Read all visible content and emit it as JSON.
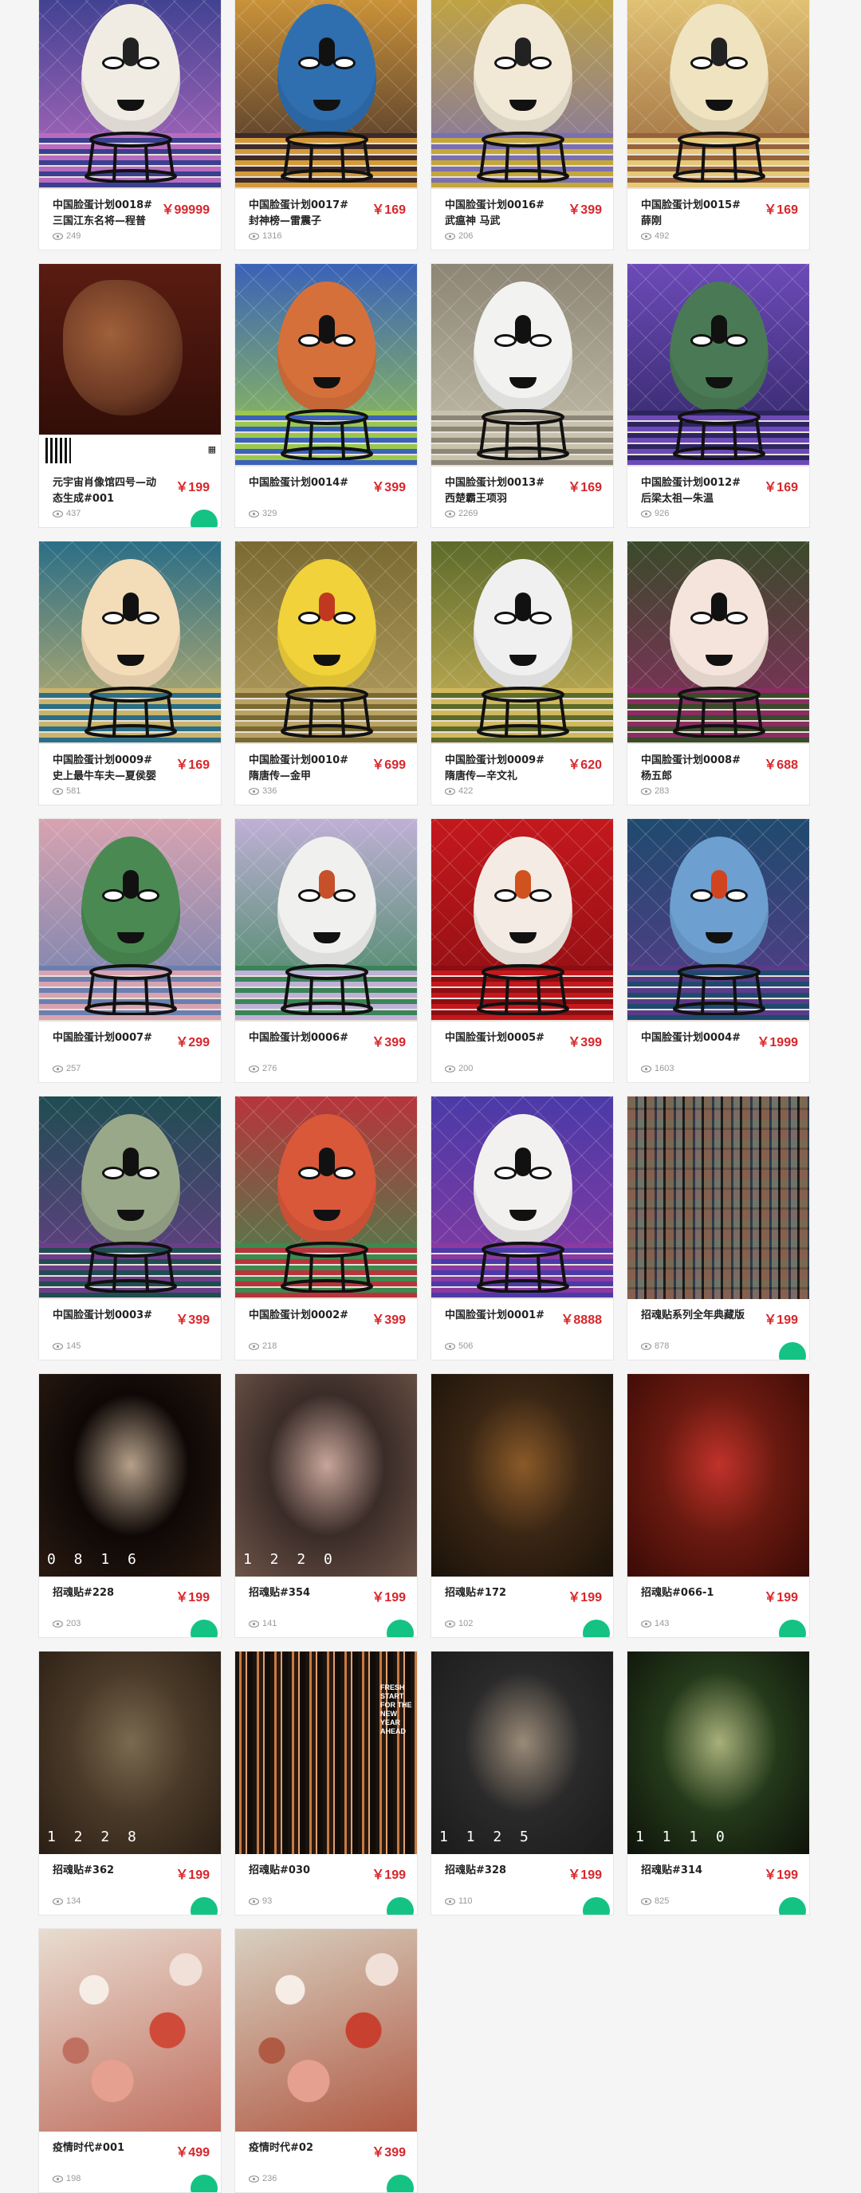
{
  "cards": [
    {
      "title": "中国脸蛋计划0018# 三国江东名将—程普",
      "price": "￥99999",
      "views": "249",
      "badge": false,
      "art": "egg",
      "bg": [
        "#3a3f8f",
        "#b86cc0"
      ],
      "egg": "#f0ece4",
      "accent": "#222"
    },
    {
      "title": "中国脸蛋计划0017# 封神榜—雷震子",
      "price": "￥169",
      "views": "1316",
      "badge": false,
      "art": "egg",
      "bg": [
        "#d49a3a",
        "#3d2a2a"
      ],
      "egg": "#2f6fb0",
      "accent": "#111"
    },
    {
      "title": "中国脸蛋计划0016# 武瘟神 马武",
      "price": "￥399",
      "views": "206",
      "badge": false,
      "art": "egg",
      "bg": [
        "#c4a73a",
        "#7a6fb3"
      ],
      "egg": "#f1e9d6",
      "accent": "#222"
    },
    {
      "title": "中国脸蛋计划0015#薛刚",
      "price": "￥169",
      "views": "492",
      "badge": false,
      "art": "egg",
      "bg": [
        "#e6c978",
        "#96623a"
      ],
      "egg": "#efe3c0",
      "accent": "#222"
    },
    {
      "title": "元宇宙肖像馆四号—动态生成#001",
      "price": "￥199",
      "views": "437",
      "badge": true,
      "art": "portrait",
      "bg": [
        "#5a1c12",
        "#2a0b06"
      ],
      "egg": "#6d3a24",
      "accent": "#111"
    },
    {
      "title": "中国脸蛋计划0014#",
      "price": "￥399",
      "views": "329",
      "badge": false,
      "art": "egg",
      "bg": [
        "#3a62b8",
        "#9ac84d"
      ],
      "egg": "#d6703b",
      "accent": "#111"
    },
    {
      "title": "中国脸蛋计划0013# 西楚霸王项羽",
      "price": "￥169",
      "views": "2269",
      "badge": false,
      "art": "egg",
      "bg": [
        "#8d8575",
        "#c6c2ad"
      ],
      "egg": "#f2f2f0",
      "accent": "#111"
    },
    {
      "title": "中国脸蛋计划0012# 后梁太祖—朱温",
      "price": "￥169",
      "views": "926",
      "badge": false,
      "art": "egg",
      "bg": [
        "#6c4ab8",
        "#2d2560"
      ],
      "egg": "#4a7a55",
      "accent": "#111"
    },
    {
      "title": "中国脸蛋计划0009# 史上最牛车夫—夏侯婴",
      "price": "￥169",
      "views": "581",
      "badge": false,
      "art": "egg",
      "bg": [
        "#2b6e86",
        "#c9b46c"
      ],
      "egg": "#f3dcb8",
      "accent": "#111"
    },
    {
      "title": "中国脸蛋计划0010# 隋唐传—金甲",
      "price": "￥699",
      "views": "336",
      "badge": false,
      "art": "egg",
      "bg": [
        "#7a6a32",
        "#b9a363"
      ],
      "egg": "#f2d23a",
      "accent": "#c0381f"
    },
    {
      "title": "中国脸蛋计划0009# 隋唐传—辛文礼",
      "price": "￥620",
      "views": "422",
      "badge": false,
      "art": "egg",
      "bg": [
        "#5c6a2a",
        "#d1b85c"
      ],
      "egg": "#f0f0f0",
      "accent": "#111"
    },
    {
      "title": "中国脸蛋计划0008#杨五郎",
      "price": "￥688",
      "views": "283",
      "badge": false,
      "art": "egg",
      "bg": [
        "#3a4a2a",
        "#8b2c63"
      ],
      "egg": "#f5e4dc",
      "accent": "#111"
    },
    {
      "title": "中国脸蛋计划0007#",
      "price": "￥299",
      "views": "257",
      "badge": false,
      "art": "egg",
      "bg": [
        "#d8a3b0",
        "#6a7fb0"
      ],
      "egg": "#4a8a52",
      "accent": "#111"
    },
    {
      "title": "中国脸蛋计划0006#",
      "price": "￥399",
      "views": "276",
      "badge": false,
      "art": "egg",
      "bg": [
        "#bfb0d6",
        "#3a8458"
      ],
      "egg": "#f0f0ee",
      "accent": "#c6502a"
    },
    {
      "title": "中国脸蛋计划0005#",
      "price": "￥399",
      "views": "200",
      "badge": false,
      "art": "egg",
      "bg": [
        "#c4181d",
        "#8a0e12"
      ],
      "egg": "#f4ece4",
      "accent": "#d0521f"
    },
    {
      "title": "中国脸蛋计划0004#",
      "price": "￥1999",
      "views": "1603",
      "badge": false,
      "art": "egg",
      "bg": [
        "#1f4a6e",
        "#5a3b8a"
      ],
      "egg": "#6d9fd1",
      "accent": "#d04420"
    },
    {
      "title": "中国脸蛋计划0003#",
      "price": "￥399",
      "views": "145",
      "badge": false,
      "art": "egg",
      "bg": [
        "#1f4d52",
        "#6e3d8a"
      ],
      "egg": "#9aa88a",
      "accent": "#111"
    },
    {
      "title": "中国脸蛋计划0002#",
      "price": "￥399",
      "views": "218",
      "badge": false,
      "art": "egg",
      "bg": [
        "#b8343b",
        "#3c8a4d"
      ],
      "egg": "#d9583a",
      "accent": "#111"
    },
    {
      "title": "中国脸蛋计划0001#",
      "price": "￥8888",
      "views": "506",
      "badge": false,
      "art": "egg",
      "bg": [
        "#4b3aa8",
        "#8b3aa0"
      ],
      "egg": "#f3f1ef",
      "accent": "#111"
    },
    {
      "title": "招魂贴系列全年典藏版",
      "price": "￥199",
      "views": "878",
      "badge": true,
      "art": "mosaic",
      "bg": [
        "#222",
        "#111"
      ],
      "egg": "#888",
      "accent": "#111"
    },
    {
      "title": "招魂贴#228",
      "price": "￥199",
      "views": "203",
      "badge": true,
      "art": "poster",
      "bg": [
        "#2a1a10",
        "#0e0806"
      ],
      "egg": "#b5a08a",
      "accent": "#fff",
      "overlay": "0 8",
      "overlay2": "1 6"
    },
    {
      "title": "招魂贴#354",
      "price": "￥199",
      "views": "141",
      "badge": true,
      "art": "poster",
      "bg": [
        "#6e5448",
        "#3a2c28"
      ],
      "egg": "#c7a59a",
      "accent": "#fff",
      "overlay": "1 2",
      "overlay2": "2 0"
    },
    {
      "title": "招魂贴#172",
      "price": "￥199",
      "views": "102",
      "badge": true,
      "art": "poster",
      "bg": [
        "#1a120a",
        "#3a2614"
      ],
      "egg": "#8a5a28",
      "accent": "#fff",
      "overlay": "",
      "overlay2": ""
    },
    {
      "title": "招魂贴#066-1",
      "price": "￥199",
      "views": "143",
      "badge": true,
      "art": "poster",
      "bg": [
        "#3a0a06",
        "#6a1a10"
      ],
      "egg": "#c0322a",
      "accent": "#fff",
      "overlay": "",
      "overlay2": ""
    },
    {
      "title": "招魂贴#362",
      "price": "￥199",
      "views": "134",
      "badge": true,
      "art": "poster",
      "bg": [
        "#2a1e14",
        "#4a3a28"
      ],
      "egg": "#7a6a50",
      "accent": "#fff",
      "overlay": "1 2",
      "overlay2": "2 8"
    },
    {
      "title": "招魂贴#030",
      "price": "￥199",
      "views": "93",
      "badge": true,
      "art": "stripes",
      "bg": [
        "#1a1410",
        "#3a2414"
      ],
      "egg": "#c87a42",
      "accent": "#fff",
      "overlay": "FRESH START FOR THE NEW YEAR AHEAD",
      "overlay2": ""
    },
    {
      "title": "招魂贴#328",
      "price": "￥199",
      "views": "110",
      "badge": true,
      "art": "poster",
      "bg": [
        "#1a1a1a",
        "#2a2a2a"
      ],
      "egg": "#9a8a78",
      "accent": "#fff",
      "overlay": "1 1",
      "overlay2": "2 5"
    },
    {
      "title": "招魂贴#314",
      "price": "￥199",
      "views": "825",
      "badge": true,
      "art": "poster",
      "bg": [
        "#0e120a",
        "#243a1a"
      ],
      "egg": "#a8b07a",
      "accent": "#fff",
      "overlay": "1 1",
      "overlay2": "1 0"
    },
    {
      "title": "疫情时代#001",
      "price": "￥499",
      "views": "198",
      "badge": true,
      "art": "flesh",
      "bg": [
        "#e8dcd0",
        "#c07060"
      ],
      "egg": "#d04a3a",
      "accent": "#fff"
    },
    {
      "title": "疫情时代#02",
      "price": "￥399",
      "views": "236",
      "badge": true,
      "art": "flesh",
      "bg": [
        "#d8d0c0",
        "#b05a44"
      ],
      "egg": "#c84030",
      "accent": "#fff"
    }
  ]
}
